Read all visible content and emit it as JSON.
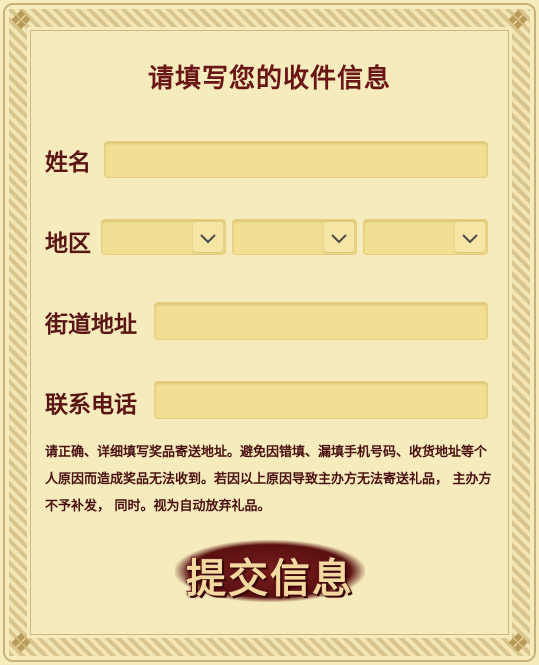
{
  "form": {
    "title": "请填写您的收件信息",
    "name_label": "姓名",
    "name_value": "",
    "region_label": "地区",
    "region_selects": [
      {
        "value": ""
      },
      {
        "value": ""
      },
      {
        "value": ""
      }
    ],
    "street_label": "街道地址",
    "street_value": "",
    "phone_label": "联系电话",
    "phone_value": "",
    "notice": "请正确、详细填写奖品寄送地址。避免因错填、漏填手机号码、收货地址等个人原因而造成奖品无法收到。若因以上原因导致主办方无法寄送礼品， 主办方不予补发， 同时。视为自动放弃礼品。",
    "submit_label": "提交信息"
  },
  "icons": {
    "select_arrow": "chevron-down-icon",
    "corner": "ornament-icon"
  },
  "colors": {
    "background": "#f6ebbd",
    "field": "#f3df93",
    "text": "#5b1414",
    "button": "#6a1616",
    "button_text": "#f4d9a0"
  }
}
